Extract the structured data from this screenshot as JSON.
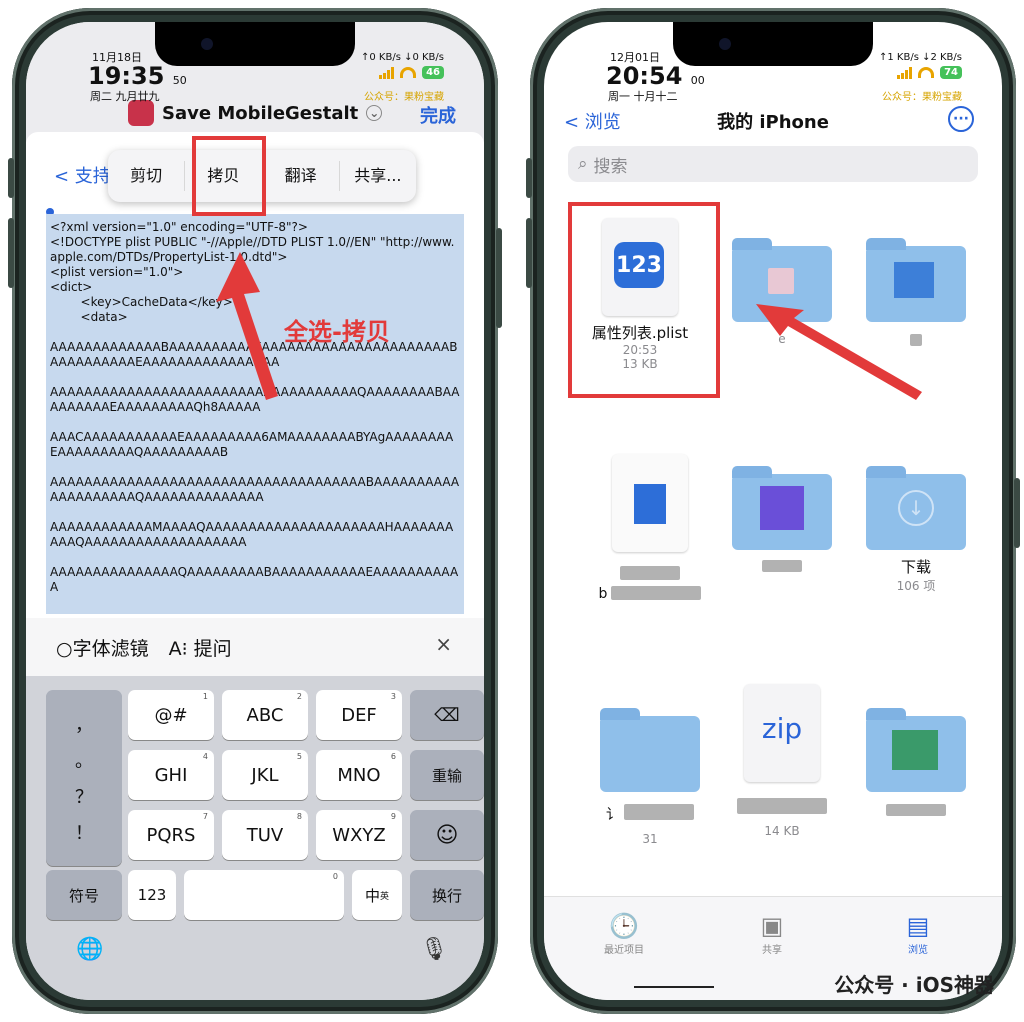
{
  "left": {
    "status": {
      "date": "11月18日",
      "time": "19:35",
      "seconds": "50",
      "lunar": "周二 九月廿九",
      "speed": "↑0 KB/s ↓0 KB/s",
      "battery": "46",
      "brand": "公众号：果粉宝藏"
    },
    "shortcut_title": "Save MobileGestalt",
    "done": "完成",
    "back": "< 支持",
    "menu": [
      "剪切",
      "拷贝",
      "翻译",
      "共享..."
    ],
    "code_lines": [
      "<?xml version=\"1.0\" encoding=\"UTF-8\"?>",
      "<!DOCTYPE plist PUBLIC \"-//Apple//DTD PLIST 1.0//EN\" \"http://www.apple.com/DTDs/PropertyList-1.0.dtd\">",
      "<plist version=\"1.0\">",
      "<dict>",
      "        <key>CacheData</key>",
      "        <data>",
      "",
      "AAAAAAAAAAAAABAAAAAAAAAAEAAAAAAAAAAAAAAAAAAAAAABAAAAAAAAAAEAAAAAAAAAAAAAQAA",
      "",
      "AAAAAAAAAAAAAAAAAAAAAAAAAAAAAAAAAAAAQAAAAAAAABAAAAAAAAAEAAAAAAAAAQh8AAAAA",
      "",
      "AAACAAAAAAAAAAAEAAAAAAAAA6AMAAAAAAAABYAgAAAAAAAAEAAAAAAAAAQAAAAAAAAAB",
      "",
      "AAAAAAAAAAAAAAAAAAAAAAAAAAAAAAAAAAAAABAAAAAAAAAAAAAAAAAAAAQAAAAAAAAAAAAAA",
      "",
      "AAAAAAAAAAAAMAAAAQAAAAAAAAAAAAAAAAAAAAAHAAAAAAAAAAQAAAAAAAAAAAAAAAAAAA",
      "",
      "AAAAAAAAAAAAAAAQAAAAAAAAABAAAAAAAAAAAEAAAAAAAAAAA"
    ],
    "annotation": "全选-拷贝",
    "kb_toolbar": {
      "filter": "○字体滤镜",
      "hint": "A⁝ 提问",
      "close": "×"
    },
    "keys": {
      "punct1": "，",
      "punct2": "。",
      "punct3": "？",
      "punct4": "！",
      "k1": "@#",
      "k2": "ABC",
      "k3": "DEF",
      "k4": "GHI",
      "k5": "JKL",
      "k6": "MNO",
      "k7": "PQRS",
      "k8": "TUV",
      "k9": "WXYZ",
      "n1": "1",
      "n2": "2",
      "n3": "3",
      "n4": "4",
      "n5": "5",
      "n6": "6",
      "n7": "7",
      "n8": "8",
      "n9": "9",
      "n0": "0",
      "backspace": "⌫",
      "reenter": "重输",
      "emoji": "☺",
      "symbol": "符号",
      "num": "123",
      "lang": "中",
      "lang_sub": "英",
      "enter": "换行",
      "globe": "🌐",
      "mic": "🎙"
    }
  },
  "right": {
    "status": {
      "date": "12月01日",
      "time": "20:54",
      "seconds": "00",
      "lunar": "周一 十月十二",
      "speed": "↑1 KB/s ↓2 KB/s",
      "battery": "74",
      "brand": "公众号：果粉宝藏"
    },
    "nav": {
      "back": "< 浏览",
      "title": "我的 iPhone",
      "more": "···"
    },
    "search_placeholder": "搜索",
    "plist": {
      "badge": "123",
      "name": "属性列表.plist",
      "time": "20:53",
      "size": "13 KB"
    },
    "downloads": {
      "name": "下载",
      "count": "106 项"
    },
    "zip": {
      "label": "zip",
      "size": "14 KB"
    },
    "misc": {
      "t1": "e",
      "t2": "d",
      "t3": "b",
      "t4": "讠",
      "t5": "31"
    },
    "tabs": [
      {
        "icon": "🕒",
        "label": "最近项目"
      },
      {
        "icon": "▣",
        "label": "共享"
      },
      {
        "icon": "▤",
        "label": "浏览"
      }
    ]
  },
  "watermark": "公众号 · iOS神器",
  "colors": {
    "accent": "#2a64d8",
    "annotation": "#e23a3a",
    "selection": "#c7d9ee",
    "folder": "#8fbfea"
  }
}
